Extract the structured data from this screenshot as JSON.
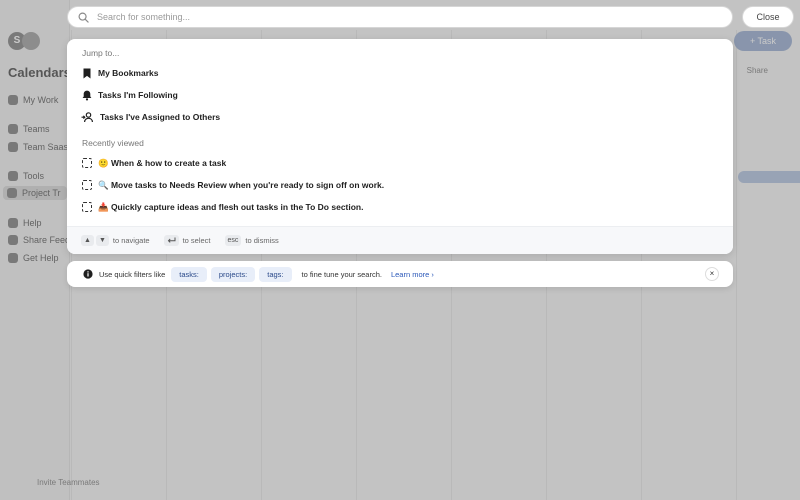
{
  "background": {
    "sidebar_title": "Calendars",
    "sidebar_items": [
      "My Work",
      "Teams",
      "Team Saas",
      "Tools",
      "Project Tr",
      "Help",
      "Share Feed",
      "Get Help"
    ],
    "avatar_letter": "S",
    "add_task_label": "+ Task",
    "share_label": "Share",
    "bottom_label": "Invite Teammates"
  },
  "search": {
    "placeholder": "Search for something...",
    "value": "",
    "close_label": "Close"
  },
  "panel": {
    "jump_label": "Jump to...",
    "jump_items": [
      {
        "label": "My Bookmarks",
        "icon": "bookmark-icon"
      },
      {
        "label": "Tasks I'm Following",
        "icon": "bell-icon"
      },
      {
        "label": "Tasks I've Assigned to Others",
        "icon": "assign-user-icon"
      }
    ],
    "recent_label": "Recently viewed",
    "recent_items": [
      {
        "label": "🙂 When & how to create a task",
        "icon": "task-icon"
      },
      {
        "label": "🔍 Move tasks to Needs Review when you're ready to sign off on work.",
        "icon": "task-icon"
      },
      {
        "label": "📥 Quickly capture ideas and flesh out tasks in the To Do section.",
        "icon": "task-icon"
      }
    ],
    "footer": {
      "navigate_hint": "to navigate",
      "select_hint": "to select",
      "esc_key": "esc",
      "dismiss_hint": "to dismiss"
    }
  },
  "info": {
    "prefix": "Use quick filters like",
    "chips": [
      "tasks:",
      "projects:",
      "tags:"
    ],
    "suffix": "to fine tune your search.",
    "learn_more": "Learn more ›",
    "dismiss": "×"
  }
}
